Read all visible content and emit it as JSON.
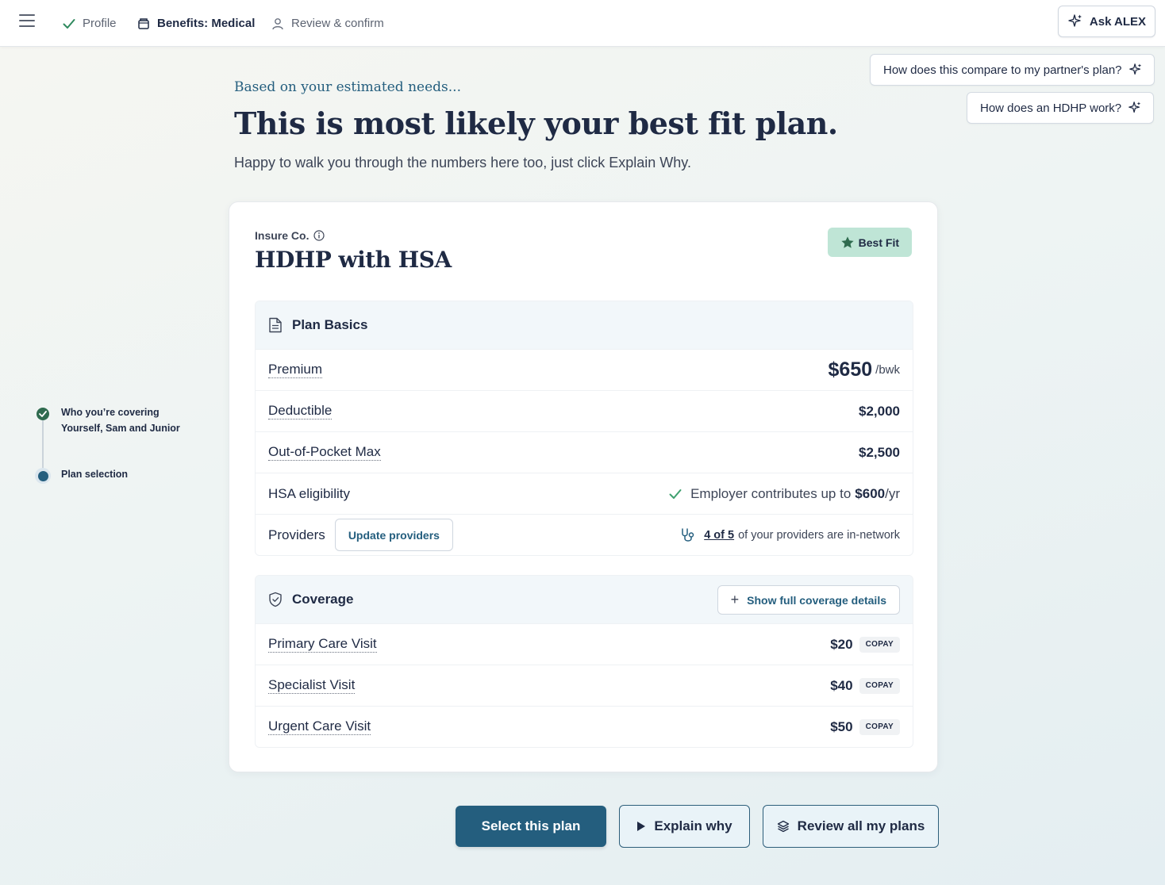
{
  "topbar": {
    "steps": [
      {
        "label": "Profile",
        "state": "done"
      },
      {
        "label": "Benefits: Medical",
        "state": "active"
      },
      {
        "label": "Review & confirm",
        "state": "upcoming"
      }
    ],
    "ask_label": "Ask ALEX"
  },
  "suggestions": [
    "How does this compare to my partner's plan?",
    "How does an HDHP work?"
  ],
  "hero": {
    "eyebrow": "Based on your estimated needs...",
    "title": "This is most likely your best fit plan.",
    "subtitle": "Happy to walk you through the numbers here too, just click Explain Why."
  },
  "sidebar": {
    "steps": [
      {
        "title": "Who you’re covering",
        "detail": "Yourself, Sam and Junior",
        "state": "done"
      },
      {
        "title": "Plan selection",
        "state": "current"
      }
    ]
  },
  "plan": {
    "insurer": "Insure Co.",
    "name": "HDHP with HSA",
    "badge": "Best Fit",
    "basics": {
      "heading": "Plan Basics",
      "premium_label": "Premium",
      "premium_value": "$650",
      "premium_unit": "/bwk",
      "deductible_label": "Deductible",
      "deductible_value": "$2,000",
      "oop_label": "Out-of-Pocket Max",
      "oop_value": "$2,500",
      "hsa_label": "HSA eligibility",
      "hsa_text": "Employer contributes up to",
      "hsa_amount": "$600",
      "hsa_unit": "/yr",
      "providers_label": "Providers",
      "update_providers": "Update providers",
      "providers_count": "4 of 5",
      "providers_text": "of your providers are in-network"
    },
    "coverage": {
      "heading": "Coverage",
      "show_details": "Show full coverage details",
      "copay_tag": "COPAY",
      "rows": [
        {
          "label": "Primary Care Visit",
          "value": "$20"
        },
        {
          "label": "Specialist Visit",
          "value": "$40"
        },
        {
          "label": "Urgent Care Visit",
          "value": "$50"
        }
      ]
    }
  },
  "actions": {
    "select": "Select this plan",
    "explain": "Explain why",
    "review": "Review all my plans"
  },
  "colors": {
    "primary": "#245e7e",
    "success": "#2f6b4f",
    "badge": "#bfe5d6",
    "text": "#1f2a44"
  },
  "icons": [
    "menu-icon",
    "check-icon",
    "clipboard-icon",
    "user-icon",
    "sparkle-icon",
    "info-icon",
    "star-icon",
    "document-icon",
    "stethoscope-icon",
    "shield-icon",
    "plus-icon",
    "play-icon",
    "layers-icon"
  ]
}
